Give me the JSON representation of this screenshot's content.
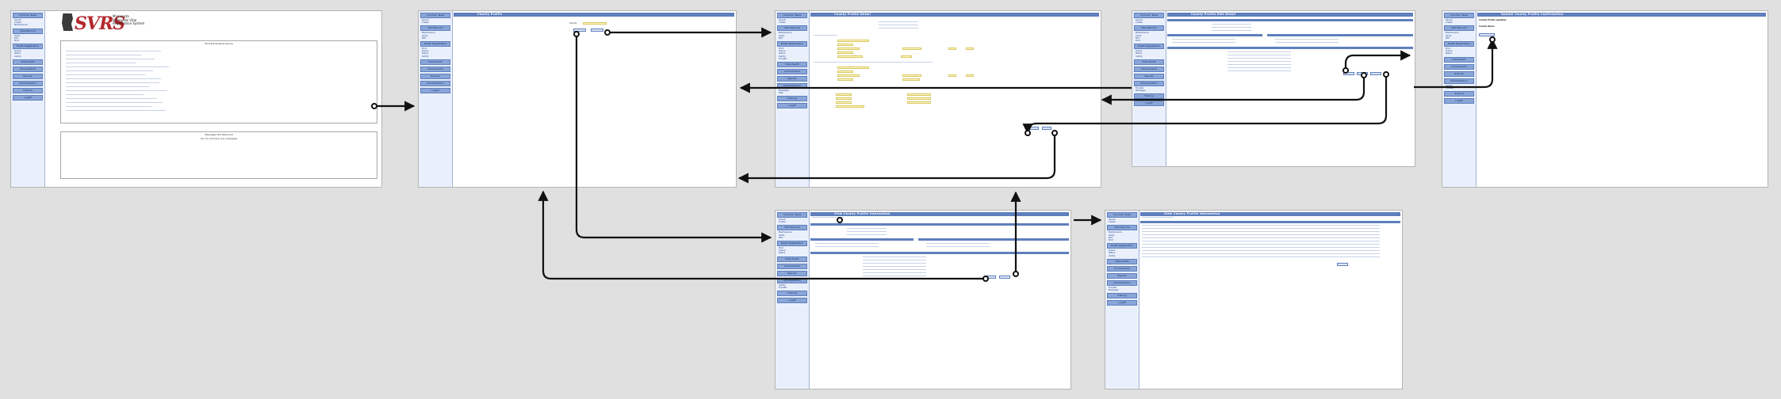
{
  "colors": {
    "accent": "#5f7fbd",
    "sidebar": "#eaf0fb",
    "field": "#fff8c8",
    "logo": "#b3282d",
    "arrow": "#111111"
  },
  "logo": {
    "text": "SVRS",
    "subtitle_lines": [
      "Minnesota",
      "Statewide Vital",
      "Registration System"
    ]
  },
  "sidebar": {
    "headers": [
      "Common Tasks",
      "Vital Records",
      "Death Registration",
      "Fetal Death",
      "Amendments",
      "Reports",
      "Administration",
      "Training",
      "Logoff"
    ],
    "items": [
      "Search",
      "Create",
      "Maintenance",
      "Verify",
      "Edit",
      "Print",
      "Queue",
      "Status",
      "Certify",
      "Transfer",
      "Messages",
      "Help"
    ]
  },
  "screens": {
    "home": {
      "panel1_title": "Worklist Pending Queue",
      "panel2_title": "Messages Not Returned",
      "panel2_text": "You do not have any messages"
    },
    "search": {
      "title": "County Profile",
      "field_label": "County"
    },
    "detail": {
      "title": "County Profile Detail"
    },
    "edit": {
      "title": "County Profile Edit Detail"
    },
    "confirm": {
      "title": "Update County Profile Confirmation",
      "line1": "County Profile updated.",
      "line2": "County Name"
    },
    "view": {
      "title": "View County Profile Information"
    },
    "audit": {
      "title": "View County Profile Information"
    }
  },
  "icons": {
    "flow_arrow": "arrow-right-icon",
    "flow_origin": "circle-dot-icon"
  }
}
